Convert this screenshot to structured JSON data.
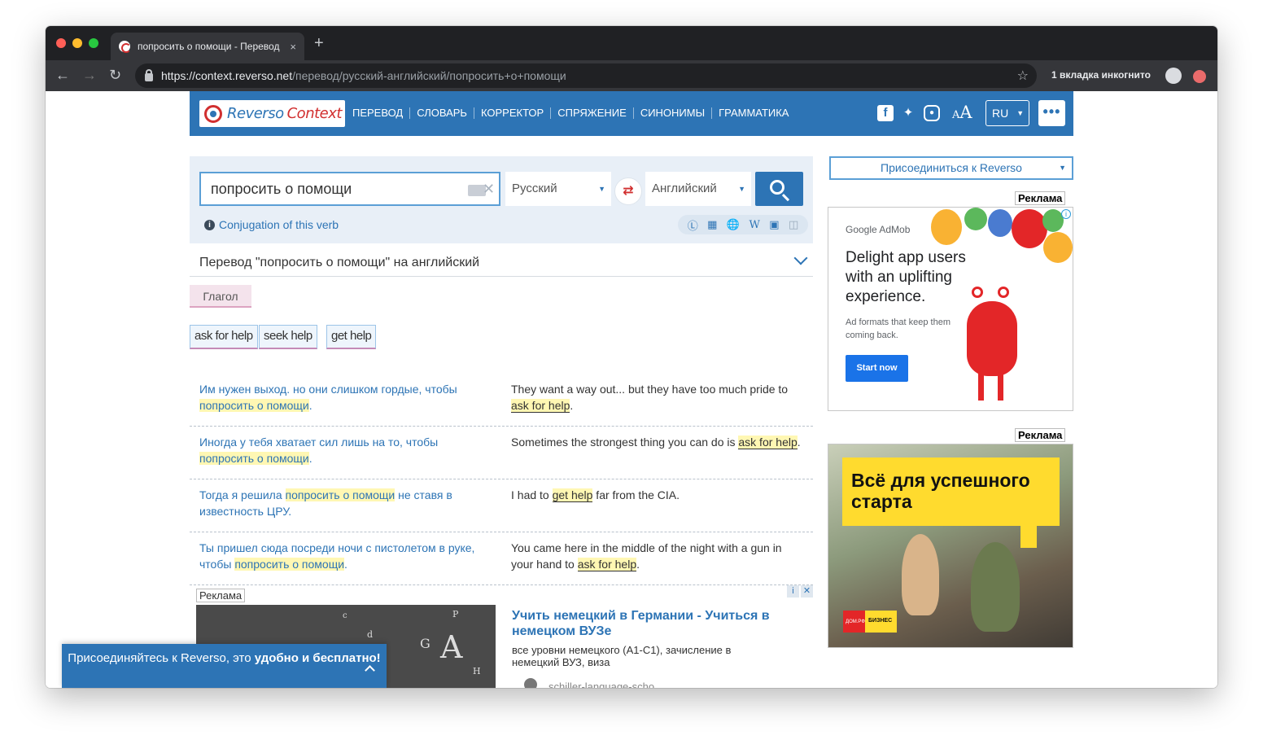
{
  "browser": {
    "tab_title": "попросить о помощи - Перевод",
    "tab_close": "×",
    "new_tab": "+",
    "url_host": "https://context.reverso.net",
    "url_path": "/перевод/русский-английский/попросить+о+помощи",
    "incognito_label": "1 вкладка инкогнито"
  },
  "site": {
    "logo_part1": "Reverso",
    "logo_part2": "Context",
    "nav": [
      "ПЕРЕВОД",
      "СЛОВАРЬ",
      "КОРРЕКТОР",
      "СПРЯЖЕНИЕ",
      "СИНОНИМЫ",
      "ГРАММАТИКА"
    ],
    "font_size_small": "A",
    "font_size_big": "A",
    "ui_language": "RU",
    "more": "•••"
  },
  "search": {
    "query": "попросить о помощи",
    "source_language": "Русский",
    "target_language": "Английский",
    "conjugation_link": "Conjugation of this verb"
  },
  "results": {
    "header": "Перевод \"попросить о помощи\" на английский",
    "part_of_speech": "Глагол",
    "translations": [
      "ask for help",
      "seek help",
      "get help"
    ],
    "examples": [
      {
        "src_before": "Им нужен выход. но они слишком гордые, чтобы ",
        "src_hl": "попросить о помощи",
        "src_after": ".",
        "tgt_before": "They want a way out... but they have too much pride to ",
        "tgt_hl": "ask for help",
        "tgt_after": "."
      },
      {
        "src_before": "Иногда у тебя хватает сил лишь на то, чтобы ",
        "src_hl": "попросить о помощи",
        "src_after": ".",
        "tgt_before": "Sometimes the strongest thing you can do is ",
        "tgt_hl": "ask for help",
        "tgt_after": "."
      },
      {
        "src_before": "Тогда я решила ",
        "src_hl": "попросить о помощи",
        "src_after": " не ставя в известность ЦРУ.",
        "tgt_before": "I had to ",
        "tgt_hl": "get help",
        "tgt_after": " far from the CIA."
      },
      {
        "src_before": "Ты пришел сюда посреди ночи с пистолетом в руке, чтобы ",
        "src_hl": "попросить о помощи",
        "src_after": ".",
        "tgt_before": "You came here in the middle of the night with a gun in your hand to ",
        "tgt_hl": "ask for help",
        "tgt_after": "."
      }
    ]
  },
  "inline_ad": {
    "label": "Реклама",
    "title": "Учить немецкий в Германии - Учиться в немецком ВУЗе",
    "text": "все уровни немецкого (A1-C1), зачисление в немецкий ВУЗ, виза",
    "url": "schiller-language-scho..."
  },
  "sidebar": {
    "join_dropdown": "Присоединиться к Reverso",
    "ad_label": "Реклама",
    "ad1": {
      "brand": "Google AdMob",
      "headline": "Delight app users with an uplifting experience.",
      "subtext": "Ad formats that keep them coming back.",
      "cta": "Start now"
    },
    "ad2": {
      "headline": "Всё для успешного старта",
      "badge": "БИЗНЕС",
      "badge_logo": "ДОМ.РФ"
    }
  },
  "join_banner": {
    "text_before": "Присоединяйтесь к Reverso, это ",
    "text_bold": "удобно и бесплатно!"
  },
  "colors": {
    "brand_blue": "#2d74b5",
    "brand_red": "#d12f2f",
    "highlight": "#fff7b3"
  }
}
